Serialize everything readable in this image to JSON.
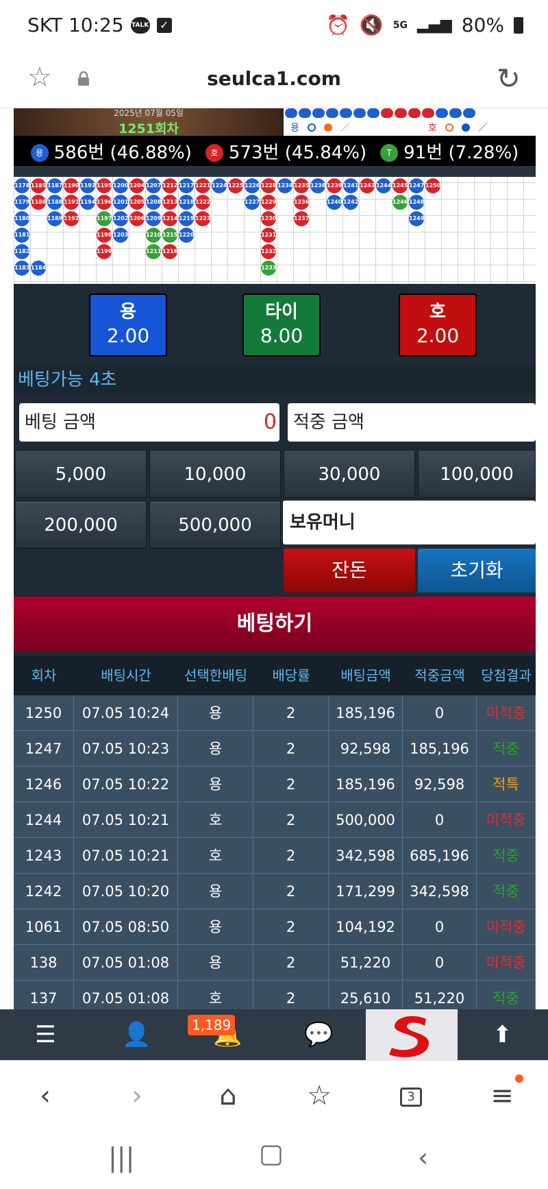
{
  "status": {
    "carrier_time": "SKT 10:25",
    "talk_badge": "TALK",
    "network": "5G",
    "battery": "80%"
  },
  "browser": {
    "url": "seulca1.com"
  },
  "banner": {
    "date": "2025년 07월 05일",
    "round": "1251회차",
    "legend_dragon": "용",
    "legend_tiger": "호"
  },
  "stats": {
    "dragon_icon": "용",
    "dragon": "586번 (46.88%)",
    "tiger_icon": "호",
    "tiger": "573번 (45.84%)",
    "tie_icon": "T",
    "tie": "91번 (7.28%)"
  },
  "board": {
    "columns": [
      [
        {
          "n": "1178",
          "c": "b"
        },
        {
          "n": "1179",
          "c": "b"
        },
        {
          "n": "1180",
          "c": "b"
        },
        {
          "n": "1181",
          "c": "b"
        },
        {
          "n": "1182",
          "c": "b"
        },
        {
          "n": "1183",
          "c": "b"
        }
      ],
      [
        {
          "n": "1185",
          "c": "r"
        },
        {
          "n": "1186",
          "c": "r"
        },
        null,
        null,
        null,
        {
          "n": "1184",
          "c": "b"
        }
      ],
      [
        {
          "n": "1187",
          "c": "b"
        },
        {
          "n": "1188",
          "c": "b"
        },
        {
          "n": "1189",
          "c": "b"
        }
      ],
      [
        {
          "n": "1190",
          "c": "r"
        },
        {
          "n": "1191",
          "c": "r"
        },
        {
          "n": "1192",
          "c": "r"
        }
      ],
      [
        {
          "n": "1193",
          "c": "b"
        },
        {
          "n": "1194",
          "c": "b"
        }
      ],
      [
        {
          "n": "1195",
          "c": "r"
        },
        {
          "n": "1196",
          "c": "r"
        },
        {
          "n": "1197",
          "c": "g"
        },
        {
          "n": "1198",
          "c": "r"
        },
        {
          "n": "1199",
          "c": "r"
        }
      ],
      [
        {
          "n": "1200",
          "c": "b"
        },
        {
          "n": "1201",
          "c": "b"
        },
        {
          "n": "1202",
          "c": "b"
        },
        {
          "n": "1203",
          "c": "b"
        }
      ],
      [
        {
          "n": "1204",
          "c": "r"
        },
        {
          "n": "1205",
          "c": "r"
        },
        {
          "n": "1206",
          "c": "r"
        }
      ],
      [
        {
          "n": "1207",
          "c": "b"
        },
        {
          "n": "1208",
          "c": "b"
        },
        {
          "n": "1209",
          "c": "b"
        },
        {
          "n": "1210",
          "c": "g"
        },
        {
          "n": "1211",
          "c": "g"
        }
      ],
      [
        {
          "n": "1212",
          "c": "r"
        },
        {
          "n": "1213",
          "c": "r"
        },
        {
          "n": "1214",
          "c": "r"
        },
        {
          "n": "1215",
          "c": "g"
        },
        {
          "n": "1216",
          "c": "r"
        }
      ],
      [
        {
          "n": "1217",
          "c": "b"
        },
        {
          "n": "1218",
          "c": "b"
        },
        {
          "n": "1219",
          "c": "b"
        },
        {
          "n": "1220",
          "c": "b"
        }
      ],
      [
        {
          "n": "1221",
          "c": "r"
        },
        {
          "n": "1222",
          "c": "r"
        },
        {
          "n": "1223",
          "c": "r"
        }
      ],
      [
        {
          "n": "1224",
          "c": "b"
        }
      ],
      [
        {
          "n": "1225",
          "c": "r"
        }
      ],
      [
        {
          "n": "1226",
          "c": "b"
        },
        {
          "n": "1227",
          "c": "b"
        }
      ],
      [
        {
          "n": "1228",
          "c": "r"
        },
        {
          "n": "1229",
          "c": "r"
        },
        {
          "n": "1230",
          "c": "r"
        },
        {
          "n": "1231",
          "c": "r"
        },
        {
          "n": "1232",
          "c": "r"
        },
        {
          "n": "1233",
          "c": "g"
        }
      ],
      [
        {
          "n": "1234",
          "c": "b"
        }
      ],
      [
        {
          "n": "1235",
          "c": "r"
        },
        {
          "n": "1236",
          "c": "r"
        },
        {
          "n": "1237",
          "c": "r"
        }
      ],
      [
        {
          "n": "1238",
          "c": "b"
        }
      ],
      [
        {
          "n": "1239",
          "c": "r"
        },
        {
          "n": "1240",
          "c": "b"
        }
      ],
      [
        {
          "n": "1241",
          "c": "b"
        },
        {
          "n": "1242",
          "c": "b"
        }
      ],
      [
        {
          "n": "1243",
          "c": "r"
        }
      ],
      [
        {
          "n": "1244",
          "c": "b"
        }
      ],
      [
        {
          "n": "1245",
          "c": "r"
        },
        {
          "n": "1246",
          "c": "g"
        }
      ],
      [
        {
          "n": "1247",
          "c": "b"
        },
        {
          "n": "1248",
          "c": "b"
        },
        {
          "n": "1249",
          "c": "b"
        }
      ],
      [
        {
          "n": "1250",
          "c": "r"
        }
      ]
    ]
  },
  "odds": {
    "dragon": {
      "name": "용",
      "value": "2.00",
      "color": "#1555d6"
    },
    "tie": {
      "name": "타이",
      "value": "8.00",
      "color": "#137a3a"
    },
    "tiger": {
      "name": "호",
      "value": "2.00",
      "color": "#c20e0e"
    }
  },
  "bet": {
    "timer": "베팅가능 4초",
    "amount_label": "베팅 금액",
    "amount_value": "0",
    "win_label": "적중 금액",
    "chips": [
      "5,000",
      "10,000",
      "30,000",
      "100,000",
      "200,000",
      "500,000"
    ],
    "wallet_label": "보유머니",
    "balance_btn": "잔돈",
    "reset_btn": "초기화",
    "submit": "베팅하기"
  },
  "history": {
    "headers": [
      "회차",
      "배팅시간",
      "선택한배팅",
      "배당률",
      "배팅금액",
      "적중금액",
      "당첨결과"
    ],
    "rows": [
      [
        "1250",
        "07.05 10:24",
        "용",
        "2",
        "185,196",
        "0",
        "미적중"
      ],
      [
        "1247",
        "07.05 10:23",
        "용",
        "2",
        "92,598",
        "185,196",
        "적중"
      ],
      [
        "1246",
        "07.05 10:22",
        "용",
        "2",
        "185,196",
        "92,598",
        "적특"
      ],
      [
        "1244",
        "07.05 10:21",
        "호",
        "2",
        "500,000",
        "0",
        "미적중"
      ],
      [
        "1243",
        "07.05 10:21",
        "호",
        "2",
        "342,598",
        "685,196",
        "적중"
      ],
      [
        "1242",
        "07.05 10:20",
        "용",
        "2",
        "171,299",
        "342,598",
        "적중"
      ],
      [
        "1061",
        "07.05 08:50",
        "용",
        "2",
        "104,192",
        "0",
        "미적중"
      ],
      [
        "138",
        "07.05 01:08",
        "용",
        "2",
        "51,220",
        "0",
        "미적중"
      ],
      [
        "137",
        "07.05 01:08",
        "호",
        "2",
        "25,610",
        "51,220",
        "적중"
      ]
    ],
    "result_colors": {
      "미적중": "#e03030",
      "적중": "#2aa52a",
      "적특": "#f0a020"
    }
  },
  "bottom_nav": {
    "notification_count": "1,189"
  },
  "browser_nav": {
    "tabs_count": "3"
  }
}
